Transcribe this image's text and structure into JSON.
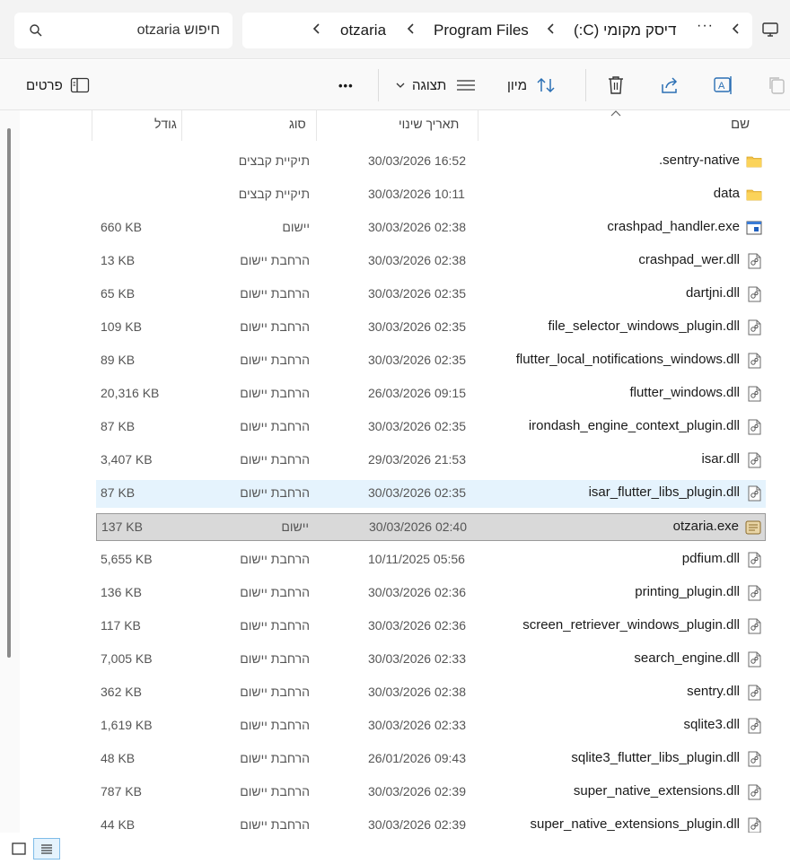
{
  "search": {
    "placeholder": "חיפוש otzaria"
  },
  "breadcrumbs": [
    "דיסק מקומי (C:)",
    "Program Files",
    "otzaria"
  ],
  "toolbar": {
    "sort_label": "מיון",
    "view_label": "תצוגה",
    "details_label": "פרטים",
    "more_label": "•••"
  },
  "columns": {
    "name": "שם",
    "date": "תאריך שינוי",
    "type": "סוג",
    "size": "גודל"
  },
  "files": [
    {
      "name": ".sentry-native",
      "date": "30/03/2026 16:52",
      "type": "תיקיית קבצים",
      "size": "",
      "icon": "folder-icon"
    },
    {
      "name": "data",
      "date": "30/03/2026 10:11",
      "type": "תיקיית קבצים",
      "size": "",
      "icon": "folder-icon"
    },
    {
      "name": "crashpad_handler.exe",
      "date": "30/03/2026 02:38",
      "type": "יישום",
      "size": "660 KB",
      "icon": "exe-icon"
    },
    {
      "name": "crashpad_wer.dll",
      "date": "30/03/2026 02:38",
      "type": "הרחבת יישום",
      "size": "13 KB",
      "icon": "dll-icon"
    },
    {
      "name": "dartjni.dll",
      "date": "30/03/2026 02:35",
      "type": "הרחבת יישום",
      "size": "65 KB",
      "icon": "dll-icon"
    },
    {
      "name": "file_selector_windows_plugin.dll",
      "date": "30/03/2026 02:35",
      "type": "הרחבת יישום",
      "size": "109 KB",
      "icon": "dll-icon"
    },
    {
      "name": "flutter_local_notifications_windows.dll",
      "date": "30/03/2026 02:35",
      "type": "הרחבת יישום",
      "size": "89 KB",
      "icon": "dll-icon"
    },
    {
      "name": "flutter_windows.dll",
      "date": "26/03/2026 09:15",
      "type": "הרחבת יישום",
      "size": "20,316 KB",
      "icon": "dll-icon"
    },
    {
      "name": "irondash_engine_context_plugin.dll",
      "date": "30/03/2026 02:35",
      "type": "הרחבת יישום",
      "size": "87 KB",
      "icon": "dll-icon"
    },
    {
      "name": "isar.dll",
      "date": "29/03/2026 21:53",
      "type": "הרחבת יישום",
      "size": "3,407 KB",
      "icon": "dll-icon"
    },
    {
      "name": "isar_flutter_libs_plugin.dll",
      "date": "30/03/2026 02:35",
      "type": "הרחבת יישום",
      "size": "87 KB",
      "icon": "dll-icon"
    },
    {
      "name": "otzaria.exe",
      "date": "30/03/2026 02:40",
      "type": "יישום",
      "size": "137 KB",
      "icon": "app-icon"
    },
    {
      "name": "pdfium.dll",
      "date": "10/11/2025 05:56",
      "type": "הרחבת יישום",
      "size": "5,655 KB",
      "icon": "dll-icon"
    },
    {
      "name": "printing_plugin.dll",
      "date": "30/03/2026 02:36",
      "type": "הרחבת יישום",
      "size": "136 KB",
      "icon": "dll-icon"
    },
    {
      "name": "screen_retriever_windows_plugin.dll",
      "date": "30/03/2026 02:36",
      "type": "הרחבת יישום",
      "size": "117 KB",
      "icon": "dll-icon"
    },
    {
      "name": "search_engine.dll",
      "date": "30/03/2026 02:33",
      "type": "הרחבת יישום",
      "size": "7,005 KB",
      "icon": "dll-icon"
    },
    {
      "name": "sentry.dll",
      "date": "30/03/2026 02:38",
      "type": "הרחבת יישום",
      "size": "362 KB",
      "icon": "dll-icon"
    },
    {
      "name": "sqlite3.dll",
      "date": "30/03/2026 02:33",
      "type": "הרחבת יישום",
      "size": "1,619 KB",
      "icon": "dll-icon"
    },
    {
      "name": "sqlite3_flutter_libs_plugin.dll",
      "date": "26/01/2026 09:43",
      "type": "הרחבת יישום",
      "size": "48 KB",
      "icon": "dll-icon"
    },
    {
      "name": "super_native_extensions.dll",
      "date": "30/03/2026 02:39",
      "type": "הרחבת יישום",
      "size": "787 KB",
      "icon": "dll-icon"
    },
    {
      "name": "super_native_extensions_plugin.dll",
      "date": "30/03/2026 02:39",
      "type": "הרחבת יישום",
      "size": "44 KB",
      "icon": "dll-icon"
    }
  ],
  "hovered_file": "isar_flutter_libs_plugin.dll",
  "selected_file": "otzaria.exe",
  "colors": {
    "accent": "#0067c0",
    "folder": "#f3c24a",
    "hover": "#e5f3fd",
    "selected": "#d9d9d9"
  }
}
